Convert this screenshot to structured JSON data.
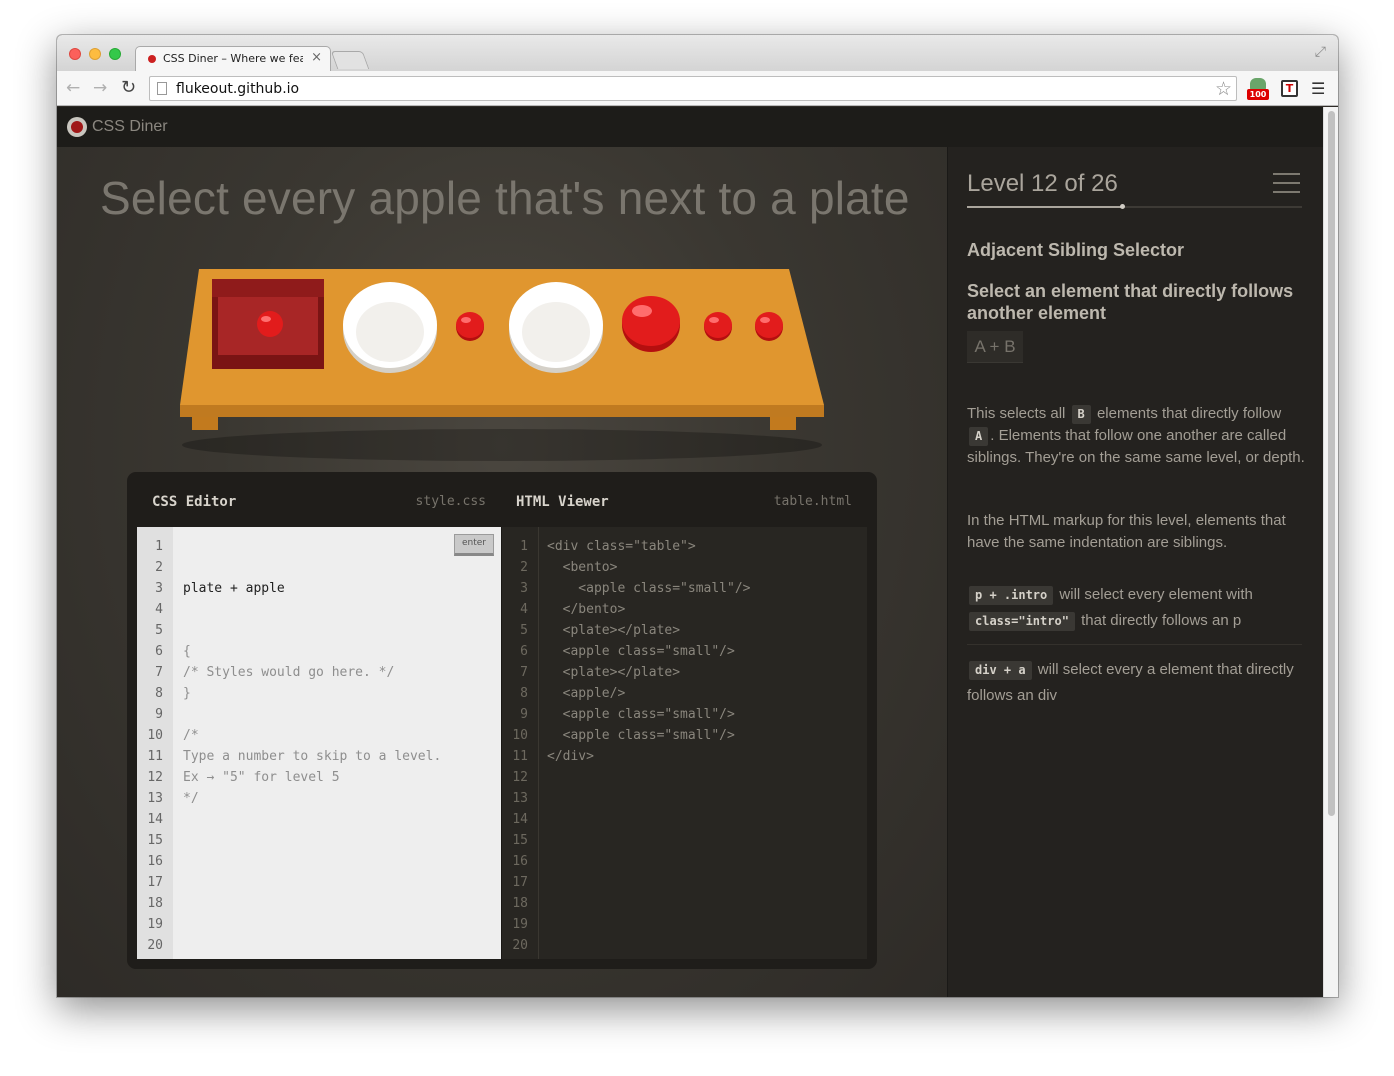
{
  "browser": {
    "tab_title": "CSS Diner – Where we feast on CSS",
    "tab_close": "×",
    "url": "flukeout.github.io",
    "ext_badge": "100",
    "ext_letter": "T"
  },
  "site": {
    "name": "CSS Diner"
  },
  "game": {
    "headline": "Select every apple that's next to a plate",
    "table_items": [
      "bento with small apple",
      "plate",
      "small apple",
      "plate",
      "apple",
      "small apple",
      "small apple"
    ]
  },
  "editor": {
    "css_title": "CSS Editor",
    "css_file": "style.css",
    "html_title": "HTML Viewer",
    "html_file": "table.html",
    "enter_label": "enter",
    "line_numbers": [
      "1",
      "2",
      "3",
      "4",
      "5",
      "6",
      "7",
      "8",
      "9",
      "10",
      "11",
      "12",
      "13",
      "14",
      "15",
      "16",
      "17",
      "18",
      "19",
      "20"
    ],
    "css_input": "plate + apple",
    "css_lines": [
      "{",
      "/* Styles would go here. */",
      "}",
      "",
      "/*",
      "Type a number to skip to a level.",
      "Ex → \"5\" for level 5",
      "*/"
    ],
    "html_lines": [
      "<div class=\"table\">",
      "  <bento>",
      "    <apple class=\"small\"/>",
      "  </bento>",
      "  <plate></plate>",
      "  <apple class=\"small\"/>",
      "  <plate></plate>",
      "  <apple/>",
      "  <apple class=\"small\"/>",
      "  <apple class=\"small\"/>",
      "</div>"
    ]
  },
  "sidebar": {
    "level_title": "Level 12 of 26",
    "level_current": 12,
    "level_total": 26,
    "selector_name": "Adjacent Sibling Selector",
    "selector_title": "Select an element that directly follows another element",
    "syntax": "A + B",
    "desc1_a": "This selects all",
    "desc1_tag_b": "B",
    "desc1_b": "elements that directly follow",
    "desc1_tag_a": "A",
    "desc1_c": ". Elements that follow one another are called siblings. They're on the same same level, or depth.",
    "desc2": "In the HTML markup for this level, elements that have the same indentation are siblings.",
    "ex1_tag": "p + .intro",
    "ex1_a": "will select every element with",
    "ex1_tag2": "class=\"intro\"",
    "ex1_b": "that directly follows an p",
    "ex2_tag": "div + a",
    "ex2_a": "will select every a element that directly follows an div"
  },
  "colors": {
    "table_wood": "#e0962f",
    "bento": "#a12424",
    "apple": "#e21c1c",
    "plate": "#ffffff",
    "page_bg": "#2b2924"
  }
}
